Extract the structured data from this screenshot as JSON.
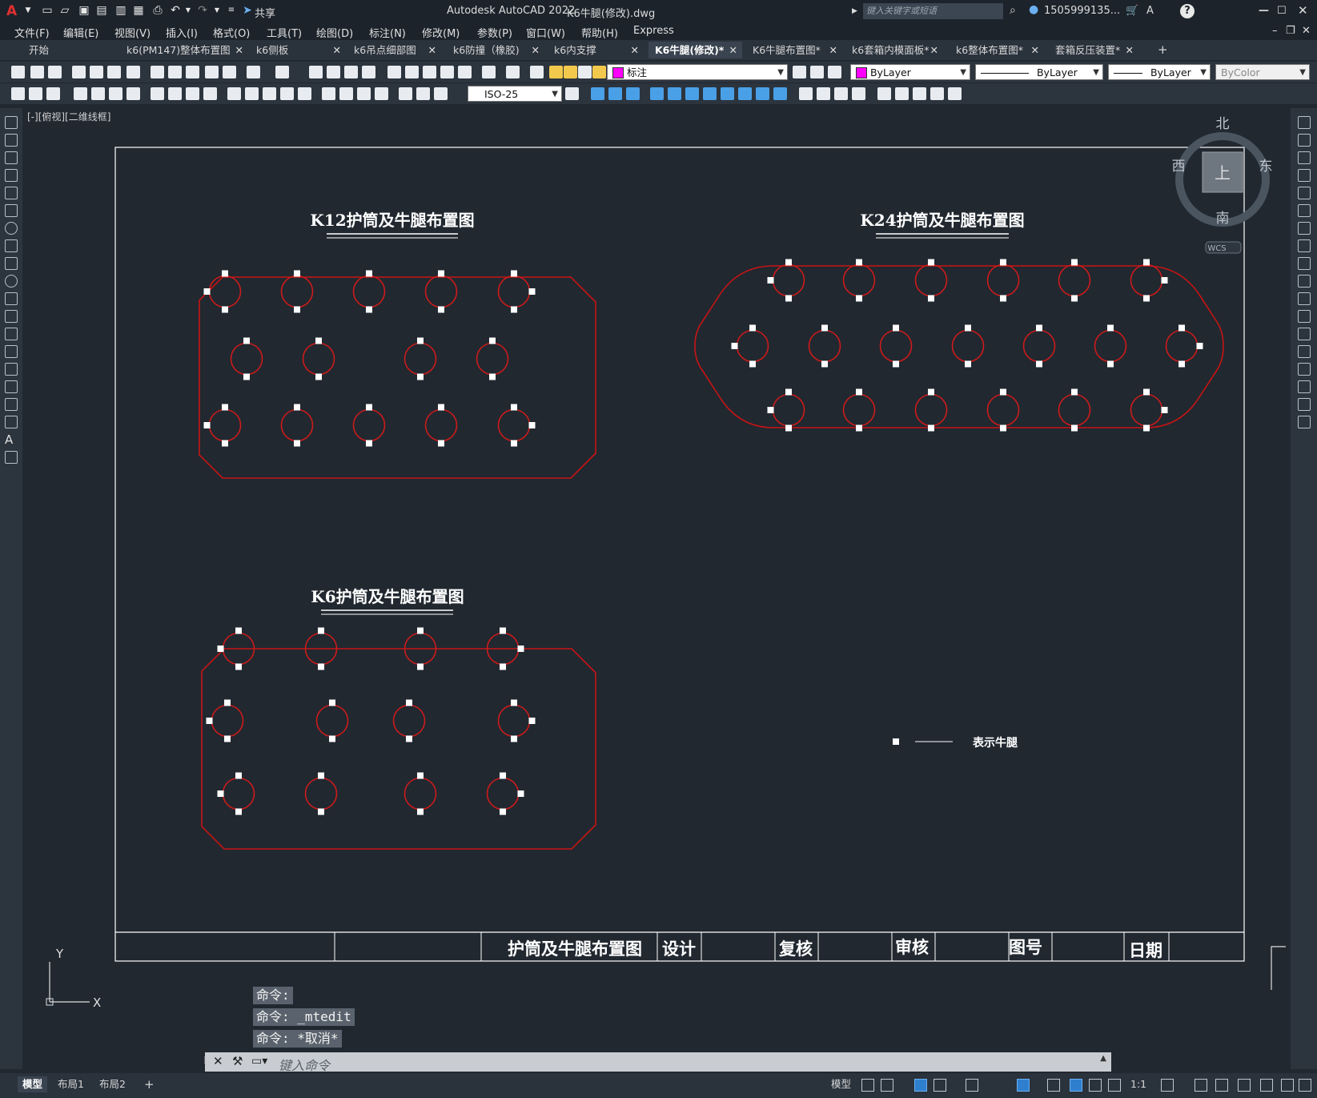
{
  "app": {
    "title": "Autodesk AutoCAD 2022",
    "filename": "K6牛腿(修改).dwg",
    "logo": "A",
    "share_label": "共享",
    "search_placeholder": "键入关键字或短语",
    "user": "1505999135...",
    "help": "?"
  },
  "menu": [
    "文件(F)",
    "编辑(E)",
    "视图(V)",
    "插入(I)",
    "格式(O)",
    "工具(T)",
    "绘图(D)",
    "标注(N)",
    "修改(M)",
    "参数(P)",
    "窗口(W)",
    "帮助(H)",
    "Express"
  ],
  "tabs": [
    {
      "label": "开始",
      "active": false
    },
    {
      "label": "k6(PM147)整体布置图",
      "active": false
    },
    {
      "label": "k6侧板",
      "active": false
    },
    {
      "label": "k6吊点细部图",
      "active": false
    },
    {
      "label": "k6防撞（橡胶)",
      "active": false
    },
    {
      "label": "k6内支撑",
      "active": false
    },
    {
      "label": "K6牛腿(修改)*",
      "active": true
    },
    {
      "label": "K6牛腿布置图*",
      "active": false
    },
    {
      "label": "k6套箱内模面板*",
      "active": false
    },
    {
      "label": "k6整体布置图*",
      "active": false
    },
    {
      "label": "套箱反压装置*",
      "active": false
    }
  ],
  "properties": {
    "layer": "标注",
    "color": "ByLayer",
    "linetype": "ByLayer",
    "lineweight": "ByLayer",
    "plotstyle": "ByColor",
    "dimstyle": "ISO-25",
    "layer_color": "#ff00ff"
  },
  "viewport_label": "[-][俯视][二维线框]",
  "viewcube": {
    "top": "上",
    "north": "北",
    "south": "南",
    "east": "东",
    "west": "西",
    "wcs": "WCS"
  },
  "drawings": {
    "k12_title": "K12护筒及牛腿布置图",
    "k24_title": "K24护筒及牛腿布置图",
    "k6_title": "K6护筒及牛腿布置图"
  },
  "legend": {
    "text": "表示牛腿"
  },
  "titleblock": {
    "name": "护筒及牛腿布置图",
    "design": "设计",
    "check": "复核",
    "review": "审核",
    "drawing_no": "图号",
    "date": "日期"
  },
  "ucs": {
    "x": "X",
    "y": "Y"
  },
  "command": {
    "history": [
      "命令:",
      "命令: _mtedit",
      "命令: *取消*"
    ],
    "placeholder": "键入命令"
  },
  "layout_tabs": [
    "模型",
    "布局1",
    "布局2"
  ],
  "status": {
    "model": "模型",
    "scale": "1:1"
  },
  "colors": {
    "circle": "#cc1b1b",
    "outline": "#c81414",
    "marker": "#ffffff",
    "background": "#212830"
  }
}
